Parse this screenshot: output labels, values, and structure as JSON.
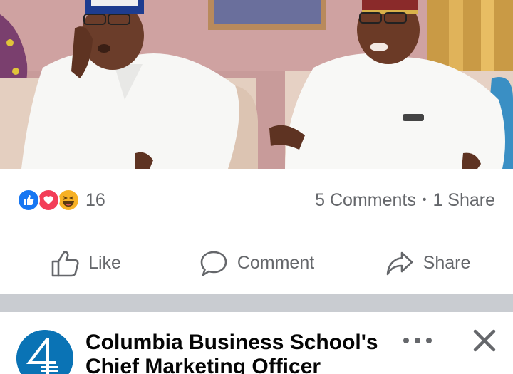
{
  "post": {
    "photo": {
      "alt": "two men in white traditional attire seated on sofas"
    },
    "reactions": {
      "icons": [
        "like-icon",
        "love-icon",
        "haha-icon"
      ],
      "count": "16"
    },
    "comments_label": "5 Comments",
    "separator": "•",
    "shares_label": "1 Share",
    "actions": {
      "like_label": "Like",
      "comment_label": "Comment",
      "share_label": "Share"
    }
  },
  "next_post": {
    "page_name": "Columbia Business School's Chief Marketing Officer",
    "more_icon": "more-horizontal-icon",
    "close_icon": "close-icon"
  },
  "colors": {
    "like_blue": "#1877f2",
    "love_red": "#f33e58",
    "haha_yellow": "#f7b125",
    "secondary_text": "#65676b",
    "divider": "#d6d9dd",
    "feed_gap": "#c9ccd1",
    "avatar_blue": "#0a73b5"
  }
}
